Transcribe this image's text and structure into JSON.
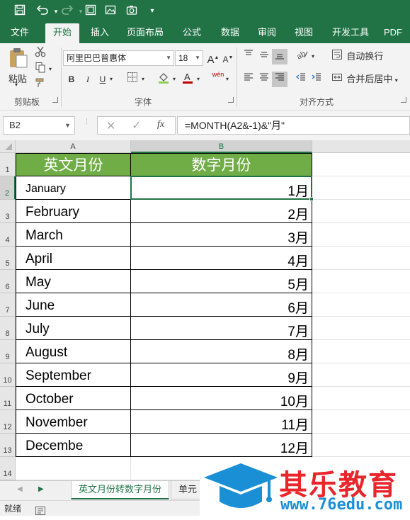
{
  "titlebar": {
    "quick_access": [
      "save-icon",
      "undo-icon",
      "redo-icon",
      "form-icon",
      "picture-icon",
      "camera-icon",
      "customize-icon"
    ]
  },
  "ribbon_tabs": [
    "文件",
    "开始",
    "插入",
    "页面布局",
    "公式",
    "数据",
    "审阅",
    "视图",
    "开发工具",
    "PDF工"
  ],
  "ribbon": {
    "clipboard": {
      "paste_label": "粘贴",
      "group_label": "剪贴板"
    },
    "font": {
      "font_name": "阿里巴巴普惠体",
      "font_size": "18",
      "bold": "B",
      "italic": "I",
      "underline": "U",
      "wen": "wén",
      "group_label": "字体"
    },
    "alignment": {
      "wrap_label": "自动换行",
      "merge_label": "合并后居中",
      "group_label": "对齐方式"
    }
  },
  "formula_bar": {
    "name_box": "B2",
    "fx": "fx",
    "formula": "=MONTH(A2&-1)&\"月\""
  },
  "sheet": {
    "columns": [
      "A",
      "B"
    ],
    "rows": [
      "1",
      "2",
      "3",
      "4",
      "5",
      "6",
      "7",
      "8",
      "9",
      "10",
      "11",
      "12",
      "13",
      "14"
    ],
    "header": [
      "英文月份",
      "数字月份"
    ],
    "data": [
      [
        "January",
        "1月"
      ],
      [
        "February",
        "2月"
      ],
      [
        "March",
        "3月"
      ],
      [
        "April",
        "4月"
      ],
      [
        "May",
        "5月"
      ],
      [
        "June",
        "6月"
      ],
      [
        "July",
        "7月"
      ],
      [
        "August",
        "8月"
      ],
      [
        "September",
        "9月"
      ],
      [
        "October",
        "10月"
      ],
      [
        "November",
        "11月"
      ],
      [
        "Decembe",
        "12月"
      ]
    ],
    "selected_cell": "B2"
  },
  "sheet_tabs": [
    "英文月份转数字月份",
    "单元"
  ],
  "status": {
    "ready": "就绪"
  },
  "watermark": {
    "brand": "其乐教育",
    "url": "www.76edu.com"
  },
  "colors": {
    "excel_green": "#217346",
    "header_fill": "#70ad47",
    "logo_blue": "#1a8fd6",
    "logo_red": "#e8262b"
  }
}
